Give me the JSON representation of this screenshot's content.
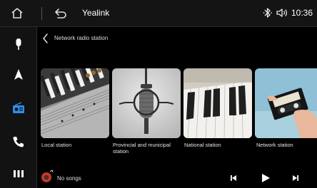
{
  "status_bar": {
    "app_name": "Yealink",
    "time": "10:36",
    "icons": [
      "home-icon",
      "back-icon",
      "bluetooth-icon",
      "volume-icon"
    ]
  },
  "sidebar": {
    "items": [
      {
        "name": "voice",
        "icon": "microphone-icon"
      },
      {
        "name": "navigation",
        "icon": "navigation-arrow-icon"
      },
      {
        "name": "radio",
        "icon": "radio-icon",
        "active": true
      },
      {
        "name": "phone",
        "icon": "phone-icon"
      },
      {
        "name": "apps",
        "icon": "apps-grid-icon"
      }
    ]
  },
  "header": {
    "title": "Network radio station"
  },
  "cards": [
    {
      "label": "Local station",
      "image": "guitar-sheet-music"
    },
    {
      "label": "Provincial and municipal station",
      "image": "studio-microphone"
    },
    {
      "label": "National station",
      "image": "piano-keys"
    },
    {
      "label": "Network station",
      "image": "hand-cassette"
    }
  ],
  "now_playing": {
    "text": "No songs",
    "icon": "music-disc-icon"
  },
  "controls": [
    "previous-icon",
    "play-icon",
    "next-icon"
  ],
  "colors": {
    "accent_blue": "#2f8ee8",
    "background": "#000000",
    "bar": "#141414"
  }
}
